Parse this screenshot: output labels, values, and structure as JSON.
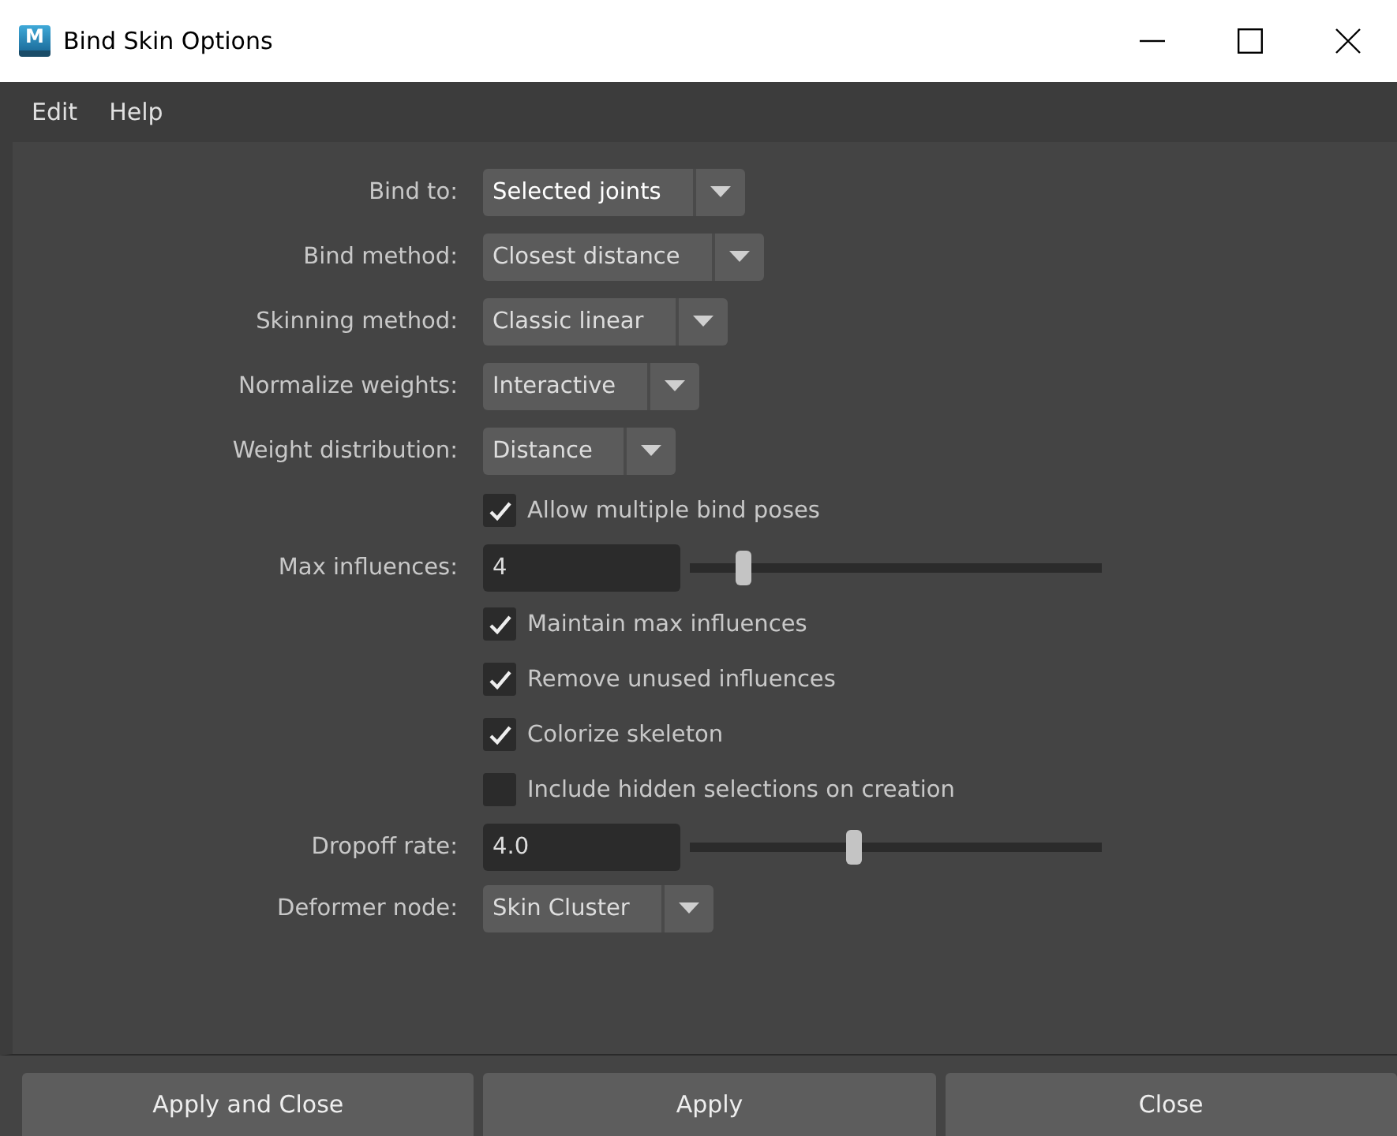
{
  "window": {
    "title": "Bind Skin Options",
    "icon_letter": "M"
  },
  "menu": [
    "Edit",
    "Help"
  ],
  "options": [
    {
      "kind": "dropdown",
      "label": "Bind to:",
      "value": "Selected joints",
      "focused": true
    },
    {
      "kind": "dropdown",
      "label": "Bind method:",
      "value": "Closest distance",
      "focused": false
    },
    {
      "kind": "dropdown",
      "label": "Skinning method:",
      "value": "Classic linear",
      "focused": false
    },
    {
      "kind": "dropdown",
      "label": "Normalize weights:",
      "value": "Interactive",
      "focused": false
    },
    {
      "kind": "dropdown",
      "label": "Weight distribution:",
      "value": "Distance",
      "focused": false
    },
    {
      "kind": "checkbox",
      "text": "Allow multiple bind poses",
      "checked": true
    },
    {
      "kind": "slider",
      "label": "Max influences:",
      "value": "4",
      "level": 0.13
    },
    {
      "kind": "checkbox",
      "text": "Maintain max influences",
      "checked": true
    },
    {
      "kind": "checkbox",
      "text": "Remove unused influences",
      "checked": true
    },
    {
      "kind": "checkbox",
      "text": "Colorize skeleton",
      "checked": true
    },
    {
      "kind": "checkbox",
      "text": "Include hidden selections on creation",
      "checked": false
    },
    {
      "kind": "slider",
      "label": "Dropoff rate:",
      "value": "4.0",
      "level": 0.4
    },
    {
      "kind": "dropdown",
      "label": "Deformer node:",
      "value": "Skin Cluster",
      "focused": false
    }
  ],
  "buttons": [
    "Apply and Close",
    "Apply",
    "Close"
  ]
}
